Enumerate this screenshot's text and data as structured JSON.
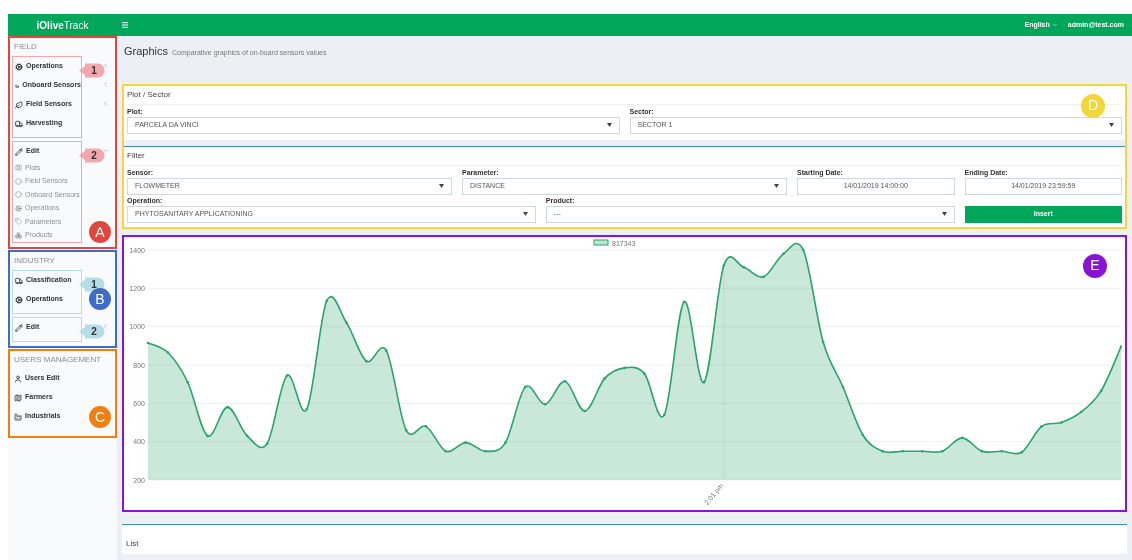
{
  "topbar": {
    "brand": "**iOlive**Track",
    "language": "English",
    "user": "admin@test.com"
  },
  "sidebar": {
    "sections": [
      {
        "header": "FIELD",
        "badge": {
          "label": "A",
          "color": "#e0463c"
        },
        "groups": [
          {
            "callout": {
              "label": "1",
              "color": "#f4a6ad"
            },
            "items": [
              {
                "label": "Operations",
                "expanded": false
              },
              {
                "label": "Onboard Sensors",
                "expanded": false
              },
              {
                "label": "Field Sensors",
                "expanded": false
              },
              {
                "label": "Harvesting"
              }
            ]
          },
          {
            "callout": {
              "label": "2",
              "color": "#f4a6ad"
            },
            "items": [
              {
                "label": "Edit",
                "expanded": true,
                "children": [
                  {
                    "label": "Plots"
                  },
                  {
                    "label": "Field Sensors"
                  },
                  {
                    "label": "Onboard Sensors"
                  },
                  {
                    "label": "Operations"
                  },
                  {
                    "label": "Parameters"
                  },
                  {
                    "label": "Products"
                  }
                ]
              }
            ]
          }
        ]
      },
      {
        "header": "INDUSTRY",
        "badge": {
          "label": "B",
          "color": "#3f6cc4"
        },
        "groups": [
          {
            "callout": {
              "label": "1",
              "color": "#b5dde6"
            },
            "items": [
              {
                "label": "Classification"
              },
              {
                "label": "Operations"
              }
            ]
          },
          {
            "callout": {
              "label": "2",
              "color": "#b5dde6"
            },
            "items": [
              {
                "label": "Edit",
                "expanded": false
              }
            ]
          }
        ]
      },
      {
        "header": "USERS MANAGEMENT",
        "badge": {
          "label": "C",
          "color": "#f07f12"
        },
        "groups": [
          {
            "items": [
              {
                "label": "Users Edit"
              },
              {
                "label": "Farmers"
              },
              {
                "label": "Industrials"
              }
            ]
          }
        ]
      }
    ]
  },
  "page": {
    "title": "Graphics",
    "subtitle": "Comparative graphics of on-board sensors values"
  },
  "form": {
    "badge": {
      "label": "D",
      "color": "#f2d63a"
    },
    "plot_sector": {
      "title": "Plot / Sector",
      "fields": [
        {
          "label": "Plot:",
          "value": "PARCELA DA VINCI",
          "kind": "select"
        },
        {
          "label": "Sector:",
          "value": "SECTOR 1",
          "kind": "select"
        }
      ]
    },
    "filter": {
      "title": "Filter",
      "fields": [
        {
          "label": "Sensor:",
          "value": "FLOWMETER",
          "kind": "select"
        },
        {
          "label": "Parameter:",
          "value": "DISTANCE",
          "kind": "select"
        },
        {
          "label": "Starting Date:",
          "value": "14/01/2019 14:00:00",
          "kind": "date"
        },
        {
          "label": "Ending Date:",
          "value": "14/01/2019 23:59:59",
          "kind": "date"
        },
        {
          "label": "Operation:",
          "value": "PHYTOSANITARY APPLICATIONING",
          "kind": "select"
        },
        {
          "label": "Product:",
          "value": "---",
          "kind": "select"
        },
        {
          "label": "Insert",
          "kind": "button"
        }
      ]
    }
  },
  "chart_panel": {
    "badge": {
      "label": "E",
      "color": "#8a14d6"
    },
    "time_label": "2:01 pm",
    "chart_data": {
      "type": "area",
      "grid": true,
      "series": [
        {
          "name": "817343",
          "color": "#2ba36b",
          "values": [
            915,
            865,
            710,
            430,
            580,
            430,
            390,
            745,
            570,
            1135,
            1020,
            820,
            875,
            460,
            480,
            350,
            395,
            350,
            395,
            685,
            595,
            715,
            560,
            730,
            785,
            755,
            540,
            1130,
            710,
            1320,
            1310,
            1260,
            1380,
            1400,
            920,
            685,
            435,
            350,
            350,
            350,
            350,
            420,
            350,
            350,
            345,
            480,
            500,
            555,
            665,
            895
          ]
        }
      ],
      "ylim": [
        200,
        1400
      ],
      "yticks": [
        200,
        400,
        600,
        800,
        1000,
        1200,
        1400
      ]
    }
  },
  "list_panel": {
    "title": "List"
  }
}
